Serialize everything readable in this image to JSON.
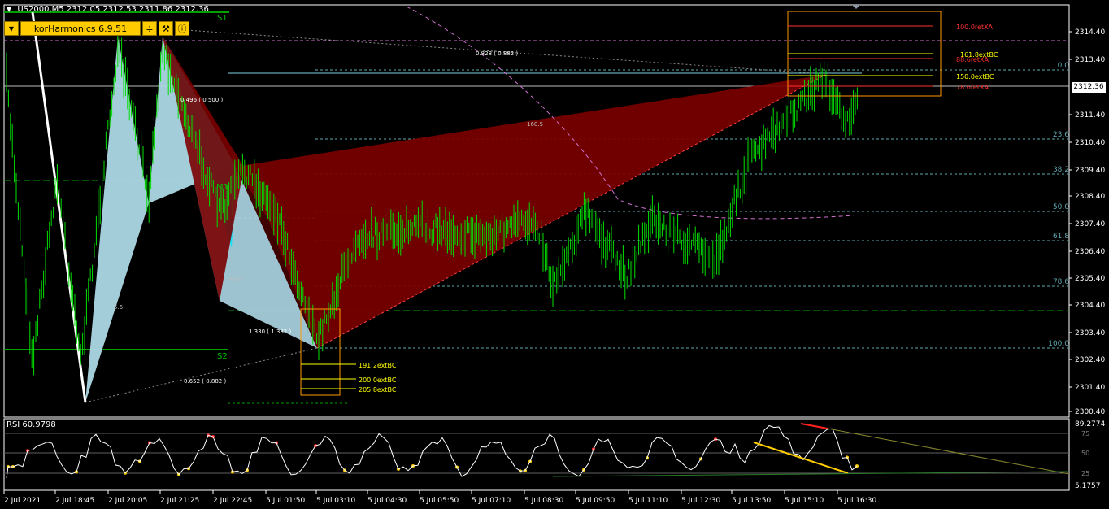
{
  "header": {
    "symbol": "US2000,M5",
    "open": "2312.05",
    "high": "2312.53",
    "low": "2311.86",
    "close": "2312.36"
  },
  "toolbar": {
    "title": "korHarmonics 6.9.51",
    "menu_icon": "dropdown-icon",
    "settings_icon": "sliders-icon",
    "tools_icon": "tools-icon",
    "info_icon": "info-icon"
  },
  "price_axis": {
    "labels": [
      "2314.40",
      "2313.40",
      "2312.36",
      "2311.40",
      "2310.40",
      "2309.40",
      "2308.40",
      "2307.40",
      "2306.40",
      "2305.40",
      "2304.40",
      "2303.40",
      "2302.40",
      "2301.40",
      "2300.40"
    ],
    "current": "2312.36"
  },
  "time_axis": [
    "2 Jul 2021",
    "2 Jul 18:45",
    "2 Jul 20:05",
    "2 Jul 21:25",
    "2 Jul 22:45",
    "5 Jul 01:50",
    "5 Jul 03:10",
    "5 Jul 04:30",
    "5 Jul 05:50",
    "5 Jul 07:10",
    "5 Jul 08:30",
    "5 Jul 09:50",
    "5 Jul 11:10",
    "5 Jul 12:30",
    "5 Jul 13:50",
    "5 Jul 15:10",
    "5 Jul 16:30"
  ],
  "fib_levels": [
    "0.0",
    "23.6",
    "38.2",
    "50.0",
    "61.8",
    "78.6",
    "100.0"
  ],
  "pattern_labels": {
    "s1": "S1",
    "s2": "S2",
    "m1": "M1",
    "r1": "0.828 ( 0.882 )",
    "r2": "0.496 ( 0.500 )",
    "r3": "1.330 ( 1.382 )",
    "r4": "0.652 ( 0.882 )",
    "faint1": "160.5",
    "faint2": "182.0",
    "faint3": "5.6"
  },
  "upper_box": [
    "100.0retXA",
    "161.8extBC",
    "88.6retXA",
    "150.0extBC",
    "78.6retXA"
  ],
  "lower_box": [
    "191.2extBC",
    "200.0extBC",
    "205.8extBC"
  ],
  "rsi": {
    "label": "RSI 60.9798",
    "max": "89.2774",
    "min": "5.1757",
    "level_hi": "75",
    "level_mid": "50",
    "level_lo": "25"
  },
  "colors": {
    "bull": "#00e000",
    "pattern_dark": "#7a0000",
    "pattern_light": "#add8e6",
    "pattern_cyan": "#00e5ff",
    "gold": "#ffcc00",
    "fib": "#5fa8b0"
  }
}
